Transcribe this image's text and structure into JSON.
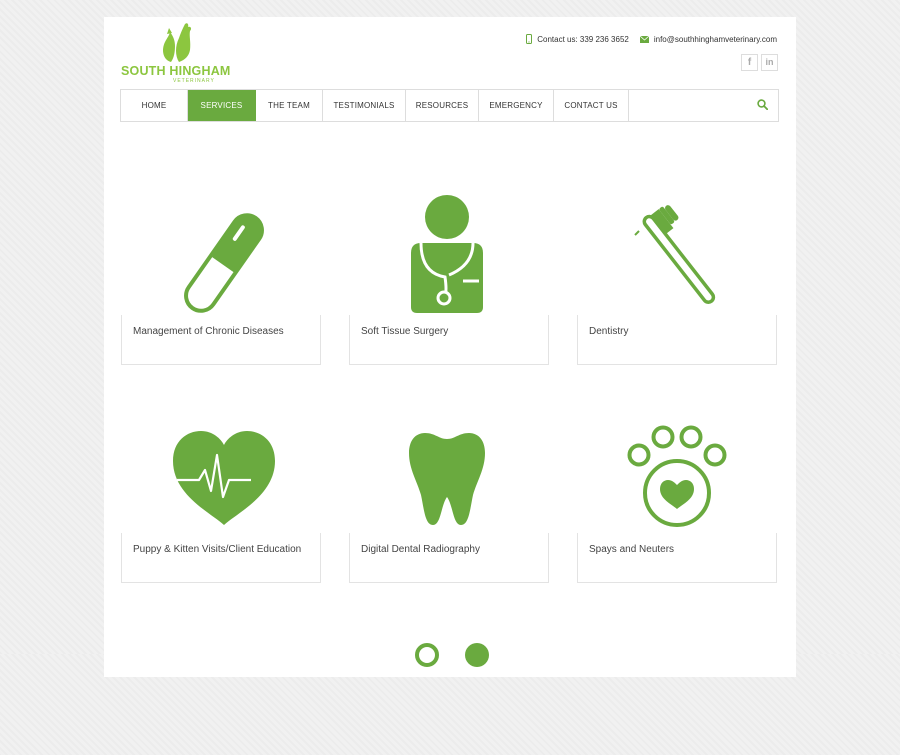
{
  "brand": {
    "name": "SOUTH HINGHAM",
    "sub": "VETERINARY",
    "accent": "#6aaa3f",
    "logo_color": "#8cc63f"
  },
  "contact": {
    "phone_label": "Contact us: 339 236 3652",
    "email": "info@southhinghamveterinary.com"
  },
  "social": {
    "facebook": "f",
    "linkedin": "in"
  },
  "nav": {
    "items": [
      {
        "label": "HOME"
      },
      {
        "label": "SERVICES"
      },
      {
        "label": "THE TEAM"
      },
      {
        "label": "TESTIMONIALS"
      },
      {
        "label": "RESOURCES"
      },
      {
        "label": "EMERGENCY"
      },
      {
        "label": "CONTACT US"
      }
    ],
    "active": "SERVICES"
  },
  "services": [
    {
      "title": "Management of Chronic Diseases",
      "icon": "pill-icon"
    },
    {
      "title": "Soft Tissue Surgery",
      "icon": "doctor-icon"
    },
    {
      "title": "Dentistry",
      "icon": "toothbrush-icon"
    },
    {
      "title": "Puppy & Kitten Visits/Client Education",
      "icon": "heart-pulse-icon"
    },
    {
      "title": "Digital Dental Radiography",
      "icon": "tooth-icon"
    },
    {
      "title": "Spays and Neuters",
      "icon": "paw-heart-icon"
    }
  ]
}
